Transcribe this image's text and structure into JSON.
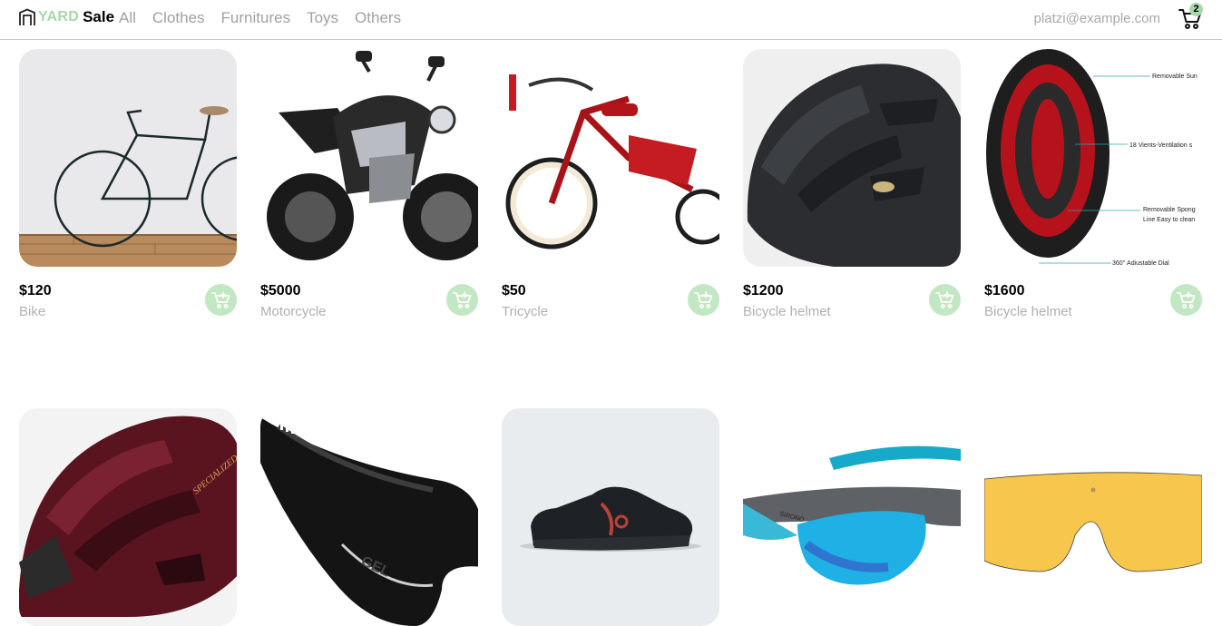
{
  "brand": {
    "yard": "YARD",
    "sale": "Sale"
  },
  "nav": {
    "links": [
      "All",
      "Clothes",
      "Furnitures",
      "Toys",
      "Others"
    ],
    "email": "platzi@example.com",
    "cart_count": "2"
  },
  "colors": {
    "accent": "#a7d8a8",
    "accent_light": "#c2e7c3",
    "muted_text": "#a0a0a0"
  },
  "products": [
    {
      "price": "$120",
      "name": "Bike",
      "image_icon": "bike-photo"
    },
    {
      "price": "$5000",
      "name": "Motorcycle",
      "image_icon": "motorcycle-photo"
    },
    {
      "price": "$50",
      "name": "Tricycle",
      "image_icon": "tricycle-photo"
    },
    {
      "price": "$1200",
      "name": "Bicycle helmet",
      "image_icon": "helmet-photo"
    },
    {
      "price": "$1600",
      "name": "Bicycle helmet",
      "image_icon": "helmet-inside-photo",
      "image_labels": [
        "Removable Sun",
        "18 Vients-Ventilation s",
        "Removable Spong",
        "Line Easy to clean",
        "360° Adiustable Dial"
      ]
    },
    {
      "image_icon": "red-helmet-photo",
      "image_text": "SPECIALIZED"
    },
    {
      "image_icon": "bike-saddle-photo",
      "image_text": "GEL"
    },
    {
      "image_icon": "shoe-photo"
    },
    {
      "image_icon": "sunglasses-photo",
      "image_text": "SIRONO"
    },
    {
      "image_icon": "yellow-lens-photo"
    }
  ]
}
